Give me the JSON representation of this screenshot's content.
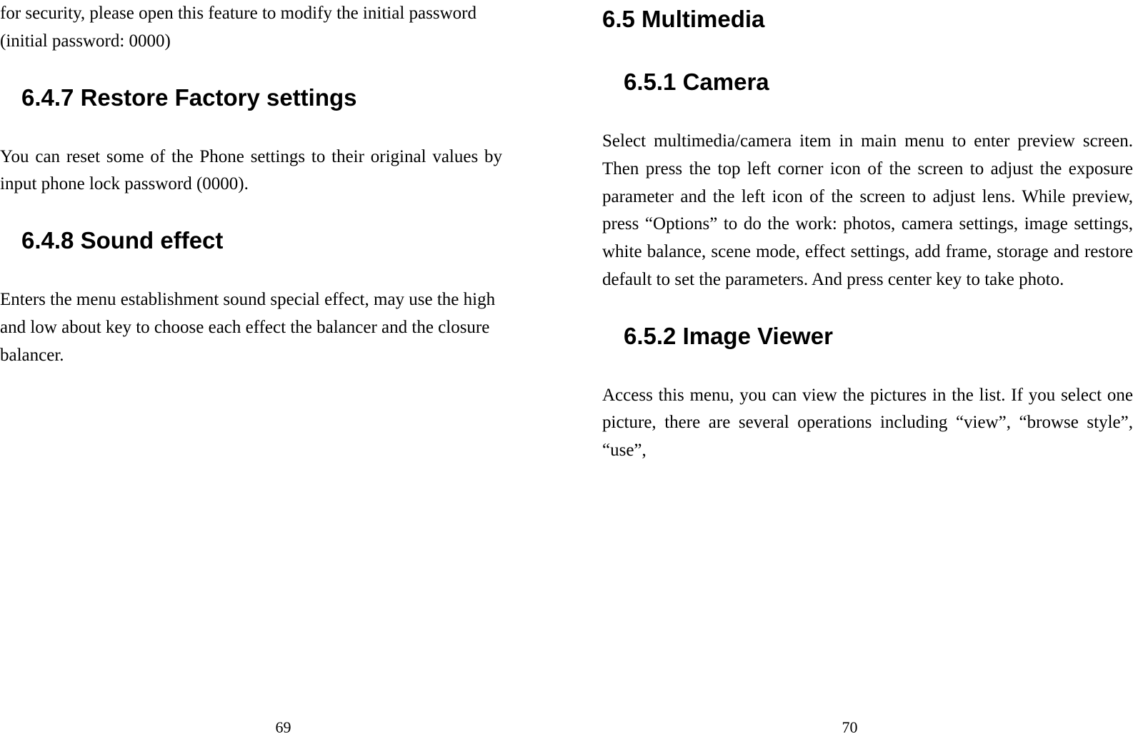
{
  "leftPage": {
    "introText": "for security, please open this feature to modify the initial password (initial password: 0000)",
    "section647": {
      "heading": "6.4.7 Restore Factory settings",
      "body": "You can reset some of the Phone settings to their original values by input phone lock password (0000)."
    },
    "section648": {
      "heading": "6.4.8 Sound effect",
      "body": "Enters the menu establishment sound special effect, may use the high and low about key to choose each effect the balancer and the closure balancer."
    },
    "pageNumber": "69"
  },
  "rightPage": {
    "section65": {
      "heading": "6.5 Multimedia"
    },
    "section651": {
      "heading": "6.5.1 Camera",
      "body": "Select multimedia/camera item in main menu to enter preview screen. Then press the top left corner icon of the screen to adjust the exposure parameter and the left icon of the screen to adjust lens. While preview, press “Options” to do the work: photos, camera settings, image settings, white balance, scene mode, effect settings, add frame, storage and restore default to set the parameters. And press center key to take photo."
    },
    "section652": {
      "heading": "6.5.2 Image Viewer",
      "body": "Access this menu, you can view the pictures in the list. If you select one picture, there are several operations including “view”, “browse style”, “use”,"
    },
    "pageNumber": "70"
  }
}
